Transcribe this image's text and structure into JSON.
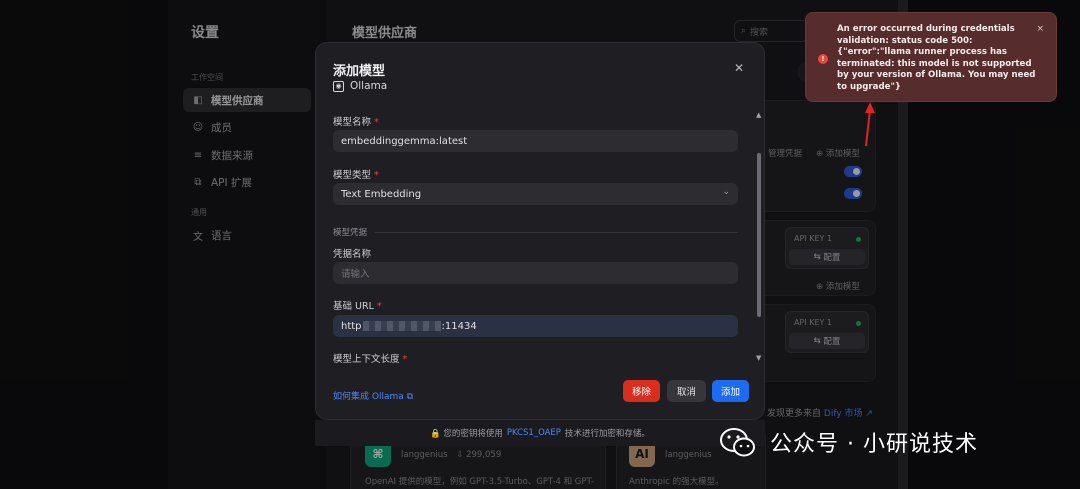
{
  "sidebar": {
    "title": "设置",
    "group_workspace": "工作空间",
    "group_general": "通用",
    "items": [
      {
        "label": "模型供应商"
      },
      {
        "label": "成员"
      },
      {
        "label": "数据来源"
      },
      {
        "label": "API 扩展"
      },
      {
        "label": "语言"
      }
    ]
  },
  "content": {
    "title": "模型供应商",
    "search_placeholder": "搜索",
    "manage_credentials": "管理凭据",
    "add_model": "添加模型",
    "add_model_2": "添加模型",
    "api_key_label": "API KEY 1",
    "api_key_label_2": "API KEY 1",
    "configure": "配置",
    "configure_2": "配置",
    "discover_prefix": "发现更多来自",
    "discover_link": "Dify 市场 ↗"
  },
  "modal": {
    "title": "添加模型",
    "provider": "Ollama",
    "model_name_label": "模型名称",
    "model_name_value": "embeddinggemma:latest",
    "model_type_label": "模型类型",
    "model_type_value": "Text Embedding",
    "credentials_section": "模型凭据",
    "credential_name_label": "凭据名称",
    "credential_name_placeholder": "请输入",
    "base_url_label": "基础 URL",
    "base_url_value_prefix": "http",
    "base_url_value_suffix": ":11434",
    "context_length_label": "模型上下文长度",
    "help_link": "如何集成 Ollama ⧉",
    "remove_label": "移除",
    "cancel_label": "取消",
    "add_label": "添加"
  },
  "footer": {
    "prefix": "🔒 您的密钥将使用",
    "key": "PKCS1_OAEP",
    "suffix": "技术进行加密和存储。"
  },
  "bottom_cards": [
    {
      "author": "langgenius",
      "downloads": "299,059",
      "desc": "OpenAI 提供的模型，例如 GPT-3.5-Turbo、GPT-4 和 GPT-"
    },
    {
      "logo": "AI",
      "author": "langgenius",
      "desc": "Anthropic 的强大模型。"
    }
  ],
  "toast": {
    "message": "An error occurred during credentials validation: status code 500: {\"error\":\"llama runner process has terminated: this model is not supported by your version of Ollama. You may need to upgrade\"}",
    "close": "×",
    "error_color": "#f04438"
  },
  "watermark": {
    "text": "公众号 · 小研说技术"
  },
  "colors": {
    "accent": "#1f6bf0",
    "danger": "#d92d20",
    "annotation_arrow": "#e02424"
  }
}
